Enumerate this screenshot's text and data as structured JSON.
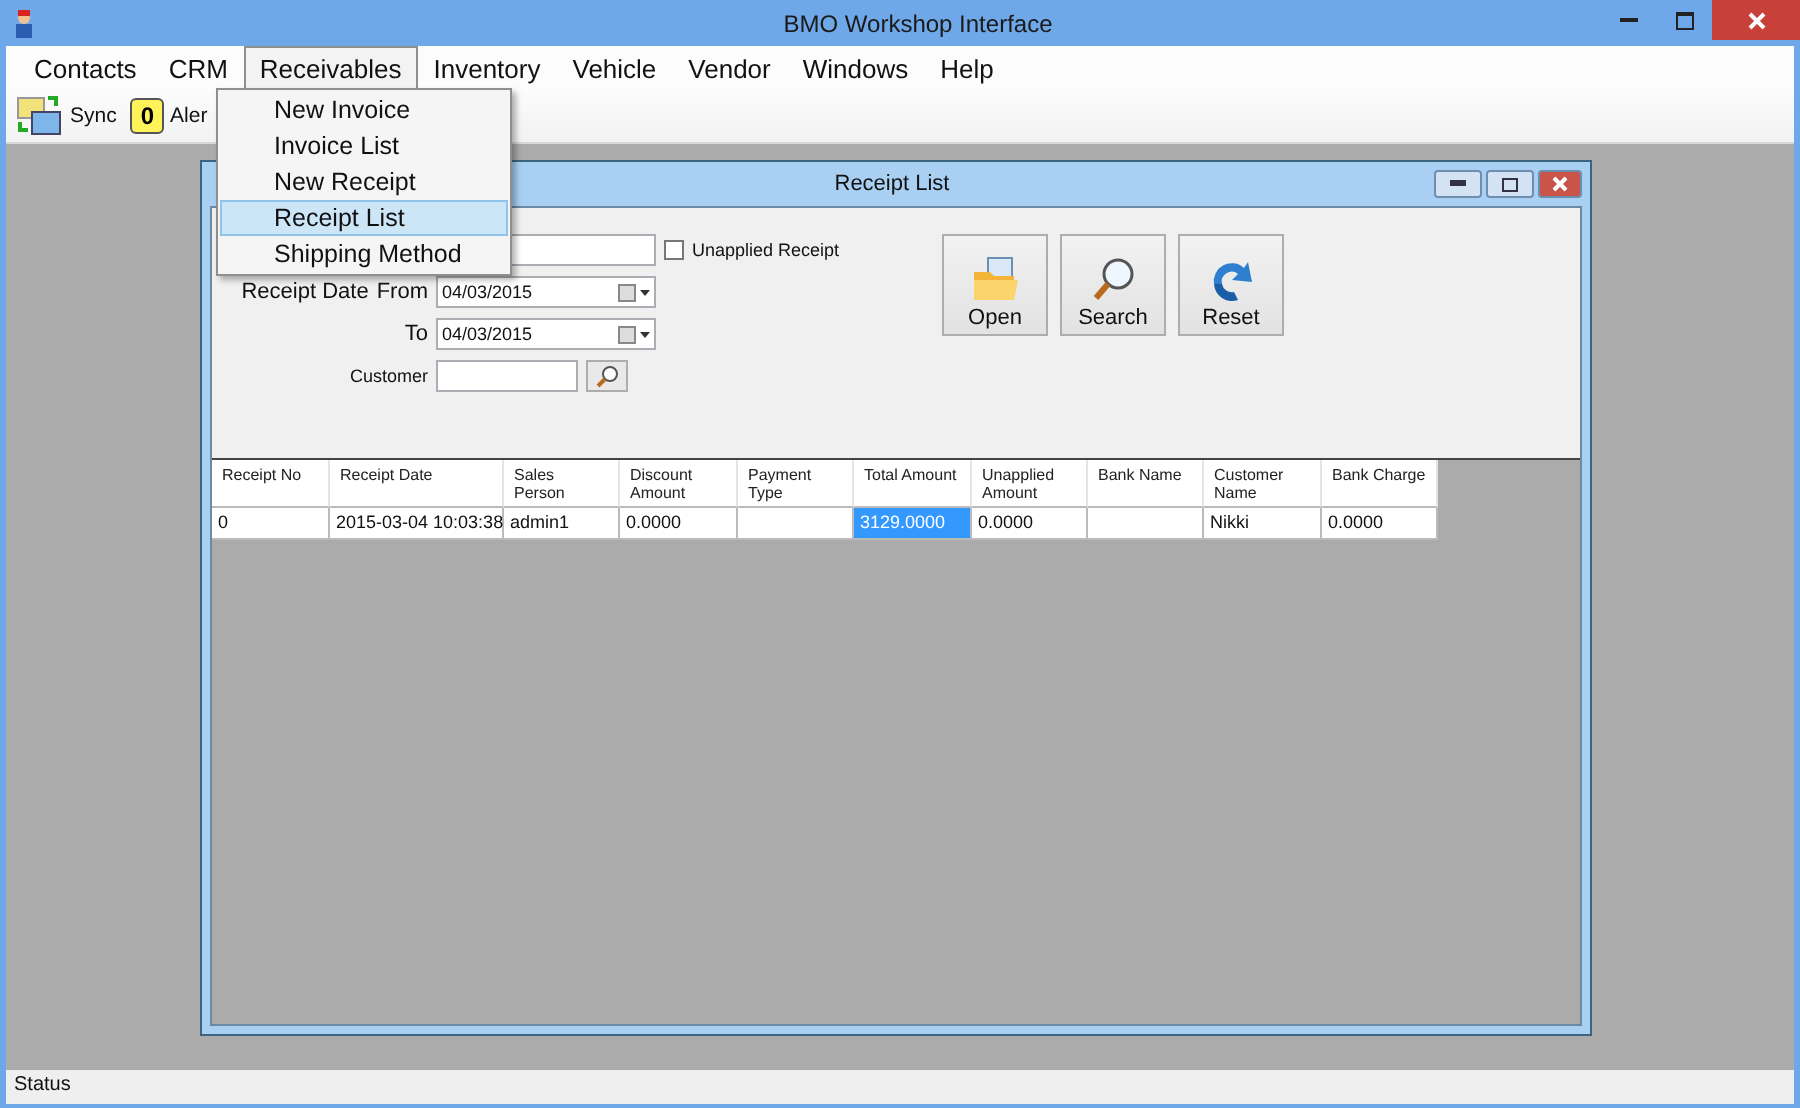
{
  "window": {
    "title": "BMO Workshop Interface"
  },
  "menu": [
    {
      "label": "Contacts",
      "selected": false
    },
    {
      "label": "CRM",
      "selected": false
    },
    {
      "label": "Receivables",
      "selected": true
    },
    {
      "label": "Inventory",
      "selected": false
    },
    {
      "label": "Vehicle",
      "selected": false
    },
    {
      "label": "Vendor",
      "selected": false
    },
    {
      "label": "Windows",
      "selected": false
    },
    {
      "label": "Help",
      "selected": false
    }
  ],
  "dropdown": [
    {
      "label": "New Invoice",
      "selected": false
    },
    {
      "label": "Invoice List",
      "selected": false
    },
    {
      "label": "New Receipt",
      "selected": false
    },
    {
      "label": "Receipt List",
      "selected": true
    },
    {
      "label": "Shipping Method",
      "selected": false
    }
  ],
  "toolbar": {
    "sync": "Sync",
    "alert_count": "0",
    "alert": "Aler"
  },
  "child_window": {
    "title": "Receipt List",
    "filters": {
      "unapplied_receipt": {
        "label": "Unapplied Receipt",
        "checked": false
      },
      "receipt_date_label": "Receipt Date",
      "from_label": "From",
      "from_value": "04/03/2015",
      "to_label": "To",
      "to_value": "04/03/2015",
      "customer_label": "Customer"
    },
    "buttons": [
      {
        "kind": "open",
        "label": "Open"
      },
      {
        "kind": "search",
        "label": "Search"
      },
      {
        "kind": "reset",
        "label": "Reset"
      }
    ],
    "table": {
      "columns": [
        "Receipt No",
        "Receipt Date",
        "Sales Person",
        "Discount Amount",
        "Payment Type",
        "Total Amount",
        "Unapplied Amount",
        "Bank Name",
        "Customer Name",
        "Bank Charge"
      ],
      "rows": [
        {
          "cells": [
            {
              "text": "0",
              "selected": false
            },
            {
              "text": "2015-03-04 10:03:38",
              "selected": false
            },
            {
              "text": "admin1",
              "selected": false
            },
            {
              "text": "0.0000",
              "selected": false
            },
            {
              "text": "",
              "selected": false
            },
            {
              "text": "3129.0000",
              "selected": true
            },
            {
              "text": "0.0000",
              "selected": false
            },
            {
              "text": "",
              "selected": false
            },
            {
              "text": "Nikki",
              "selected": false
            },
            {
              "text": "0.0000",
              "selected": false
            }
          ]
        }
      ]
    }
  },
  "status_bar": "Status"
}
